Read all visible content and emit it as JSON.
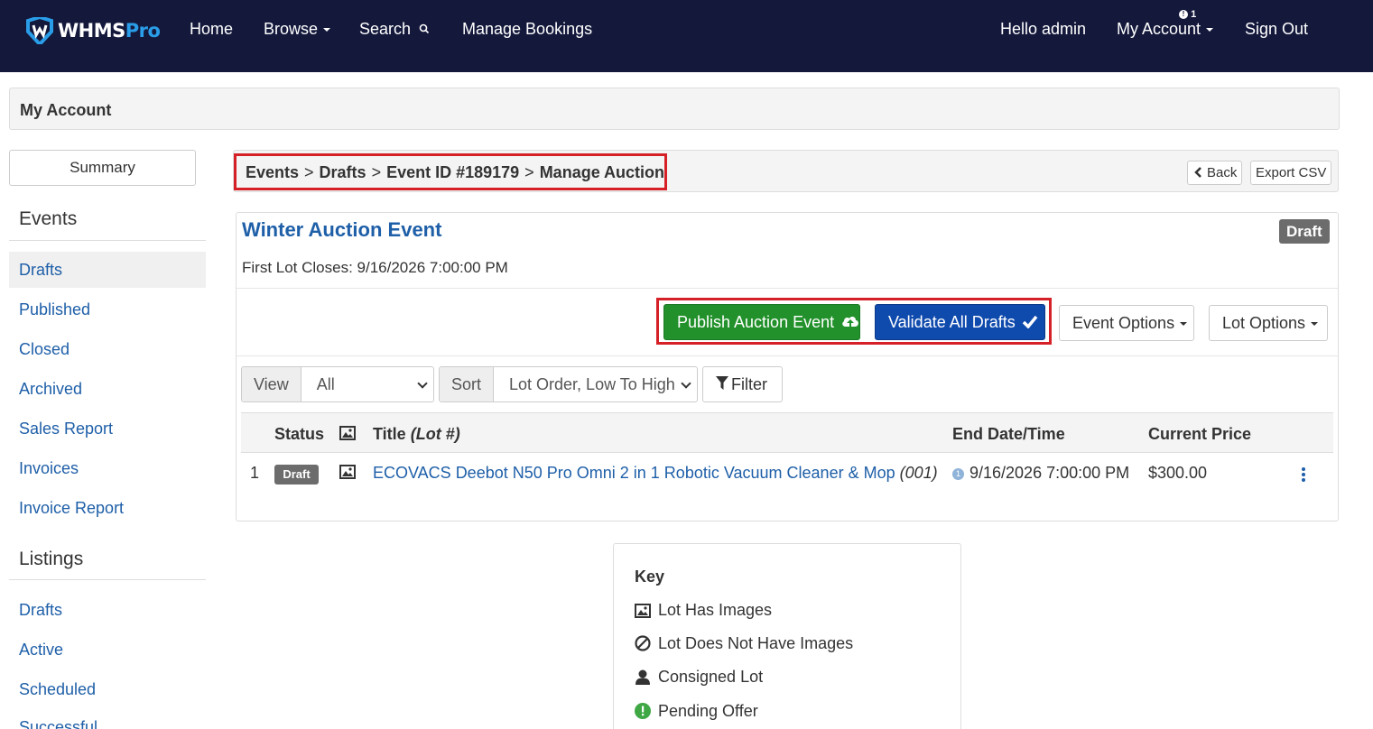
{
  "nav": {
    "logo_text_w": "WHMS",
    "logo_text_p": "Pro",
    "home": "Home",
    "browse": "Browse",
    "search": "Search",
    "manage_bookings": "Manage Bookings",
    "hello": "Hello admin",
    "my_account": "My Account",
    "notif_count": "1",
    "sign_out": "Sign Out"
  },
  "header": {
    "title": "My Account"
  },
  "sidebar": {
    "summary": "Summary",
    "events_heading": "Events",
    "events_items": [
      "Drafts",
      "Published",
      "Closed",
      "Archived",
      "Sales Report",
      "Invoices",
      "Invoice Report"
    ],
    "listings_heading": "Listings",
    "listings_items": [
      "Drafts",
      "Active",
      "Scheduled",
      "Successful"
    ]
  },
  "breadcrumb": {
    "events": "Events",
    "drafts": "Drafts",
    "event_id": "Event ID #189179",
    "manage": "Manage Auction",
    "sep": ">",
    "back": "Back",
    "export": "Export CSV"
  },
  "event": {
    "title": "Winter Auction Event",
    "status": "Draft",
    "first_lot_closes": "First Lot Closes: 9/16/2026 7:00:00 PM",
    "publish_btn": "Publish Auction Event",
    "validate_btn": "Validate All Drafts",
    "event_options": "Event Options",
    "lot_options": "Lot Options"
  },
  "filters": {
    "view_label": "View",
    "view_value": "All",
    "sort_label": "Sort",
    "sort_value": "Lot Order, Low To High",
    "filter_btn": "Filter"
  },
  "table": {
    "headers": {
      "status": "Status",
      "title": "Title",
      "lot": "(Lot #)",
      "end": "End Date/Time",
      "price": "Current Price"
    },
    "rows": [
      {
        "num": "1",
        "status": "Draft",
        "title": "ECOVACS Deebot N50 Pro Omni 2 in 1 Robotic Vacuum Cleaner & Mop",
        "lot": "(001)",
        "info": "1",
        "end": "9/16/2026 7:00:00 PM",
        "price": "$300.00"
      }
    ]
  },
  "key": {
    "title": "Key",
    "items": [
      "Lot Has Images",
      "Lot Does Not Have Images",
      "Consigned Lot",
      "Pending Offer"
    ]
  },
  "colors": {
    "nav_bg": "#14193c",
    "link": "#1e5fa8",
    "green": "#22912b",
    "blue": "#0f4aad",
    "highlight": "#d62027"
  }
}
